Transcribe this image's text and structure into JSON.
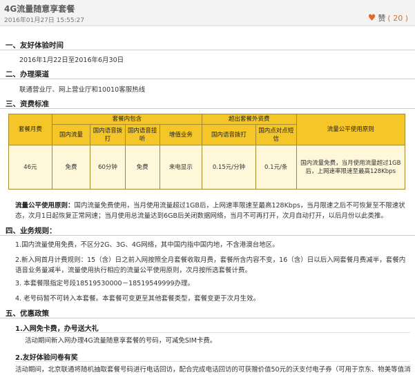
{
  "header": {
    "title": "4G流量随意享套餐",
    "date": "2016年01月27日 15:55:27",
    "like_label": "赞",
    "like_count": "( 20 )"
  },
  "sections": {
    "s1_title": "一、友好体验时间",
    "s1_text": "2016年1月22日至2016年6月30日",
    "s2_title": "二、办理渠道",
    "s2_text": "联通营业厅、网上营业厅和10010客服热线",
    "s3_title": "三、资费标准",
    "s4_title": "四、业务规则：",
    "s5_title": "五、优惠政策"
  },
  "table": {
    "h_package_fee": "套餐月费",
    "h_included": "套餐内包含",
    "h_overage": "超出套餐外资费",
    "h_principle": "流量公平使用原则",
    "c_domestic_data": "国内流量",
    "c_domestic_call": "国内语音拨打",
    "c_domestic_receive": "国内语音接听",
    "c_value_added": "增值业务",
    "c_over_call": "国内语音拨打",
    "c_over_sms": "国内点对点短信",
    "v_fee": "46元",
    "v_data": "免费",
    "v_call": "60分钟",
    "v_receive": "免费",
    "v_vas": "来电显示",
    "v_over_call": "0.15元/分钟",
    "v_over_sms": "0.1元/条",
    "v_principle": "国内流量免费，当月使用流量超过1GB后，上网速率限速至最高128Kbps"
  },
  "principle": {
    "label": "流量公平使用原则：",
    "text": "国内流量免费使用，当月使用流量超过1GB后，上网速率限速至最高128Kbps，当月限速之后不可恢复至不限速状态，次月1日起恢复正常网速；当月使用总流量达到6GB后关闭数据网络，当月不可再打开，次月自动打开，以后月份以此类推。"
  },
  "rules": {
    "r1": "1.国内流量使用免费，不区分2G、3G、4G网络，其中国内指中国内地，不含港澳台地区。",
    "r2": "2.新入网首月计费规则：15（含）日之前入网按照全月套餐收取月费，套餐所含内容不变，16（含）日以后入网套餐月费减半，套餐内语音业务量减半，流量使用执行相应的流量公平使用原则，次月按所选套餐计费。",
    "r3": "3. 本套餐限指定号段18519530000－18519549999办理。",
    "r4": "4. 老号码暂不可转入本套餐。本套餐可变更至其他套餐类型，套餐变更于次月生效。"
  },
  "offers": {
    "o1_title": "1.入网免卡费，办号送大礼",
    "o1_text": "活动期间新入网办理4G流量随意享套餐的号码，可减免SIM卡费。",
    "o2_title": "2.友好体验问卷有奖",
    "o2_text": "活动期间，北京联通将随机抽取套餐号码进行电话回访，配合完成电话回访的可获赠价值50元的沃支付电子券（可用于京东、物美等值消"
  }
}
